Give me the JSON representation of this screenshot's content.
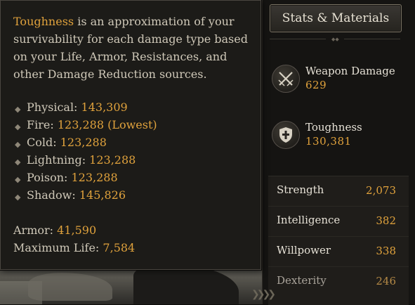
{
  "tooltip": {
    "description_prefix": "Toughness",
    "description_rest": " is an approximation of your survivability for each damage type based on your Life, Armor, Resistances, and other Damage Reduction sources.",
    "damage_types": [
      {
        "label": "Physical:",
        "value": "143,309"
      },
      {
        "label": "Fire:",
        "value": "123,288 (Lowest)"
      },
      {
        "label": "Cold:",
        "value": "123,288"
      },
      {
        "label": "Lightning:",
        "value": "123,288"
      },
      {
        "label": "Poison:",
        "value": "123,288"
      },
      {
        "label": "Shadow:",
        "value": "145,826"
      }
    ],
    "armor_label": "Armor:",
    "armor_value": "41,590",
    "life_label": "Maximum Life:",
    "life_value": "7,584"
  },
  "panel": {
    "tab_label": "Stats & Materials",
    "weapon_damage_label": "Weapon Damage",
    "weapon_damage_value": "629",
    "toughness_label": "Toughness",
    "toughness_value": "130,381",
    "attributes": [
      {
        "name": "Strength",
        "value": "2,073"
      },
      {
        "name": "Intelligence",
        "value": "382"
      },
      {
        "name": "Willpower",
        "value": "338"
      },
      {
        "name": "Dexterity",
        "value": "246"
      }
    ]
  },
  "colors": {
    "accent_gold": "#e0a23c",
    "text_light": "#cfc8b8",
    "panel_bg": "#151412"
  },
  "icons": [
    "crossed-swords-icon",
    "shield-icon",
    "chevron-right-icon",
    "diamond-ornament-icon"
  ]
}
